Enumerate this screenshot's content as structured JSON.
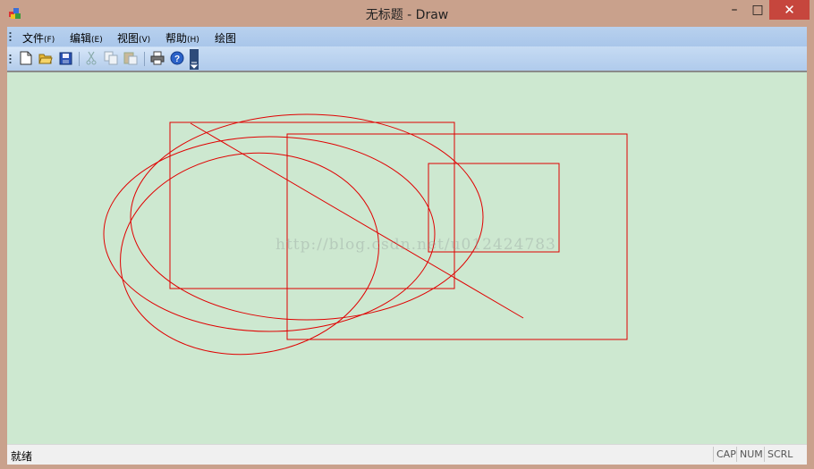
{
  "window": {
    "title": "无标题 - Draw",
    "controls": {
      "minimize": "–",
      "maximize": "□",
      "close": "✕"
    }
  },
  "menubar": {
    "items": [
      {
        "label": "文件",
        "accel": "(F)"
      },
      {
        "label": "编辑",
        "accel": "(E)"
      },
      {
        "label": "视图",
        "accel": "(V)"
      },
      {
        "label": "帮助",
        "accel": "(H)"
      },
      {
        "label": "绘图",
        "accel": ""
      }
    ]
  },
  "toolbar": {
    "buttons": [
      "new-file-icon",
      "open-folder-icon",
      "save-icon",
      "cut-icon",
      "copy-icon",
      "paste-icon",
      "print-icon",
      "help-icon"
    ]
  },
  "canvas": {
    "background": "#cde8d0",
    "stroke": "#e00000",
    "watermark": "http://blog.csdn.net/u012424783"
  },
  "statusbar": {
    "text": "就绪",
    "indicators": [
      "CAP",
      "NUM",
      "SCRL"
    ]
  }
}
